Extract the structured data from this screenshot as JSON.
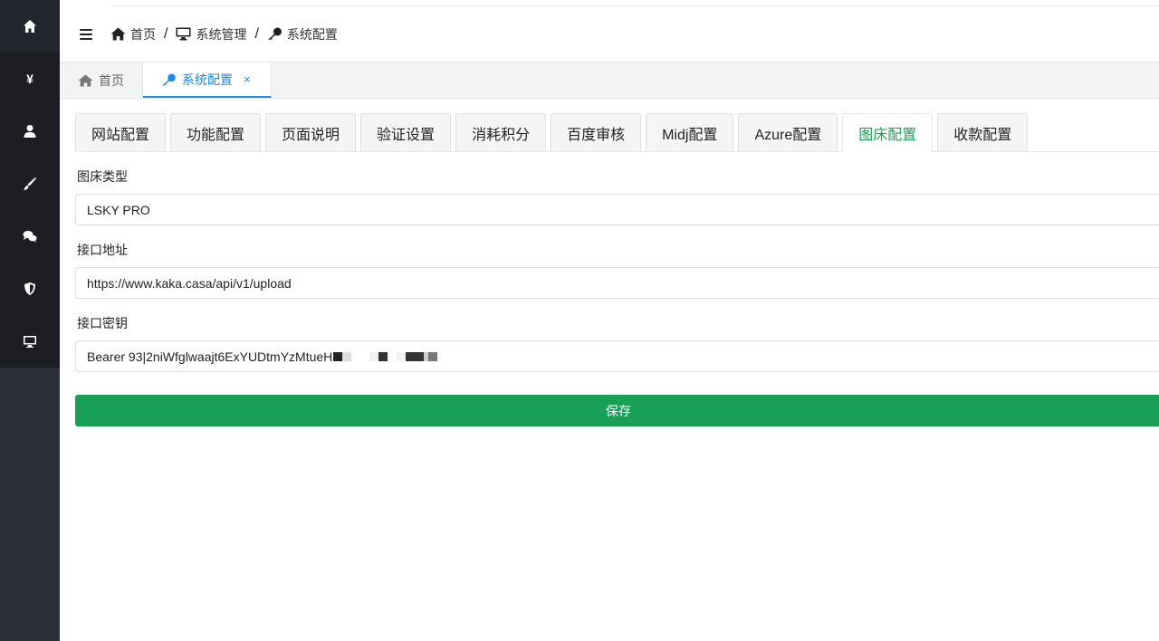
{
  "sidebar": {
    "items": [
      {
        "name": "home",
        "icon": "home-icon"
      },
      {
        "name": "finance",
        "icon": "yen-icon",
        "glyph": "¥"
      },
      {
        "name": "users",
        "icon": "user-icon"
      },
      {
        "name": "drawing",
        "icon": "brush-icon"
      },
      {
        "name": "chat",
        "icon": "chat-icon"
      },
      {
        "name": "security",
        "icon": "shield-icon"
      },
      {
        "name": "system",
        "icon": "monitor-icon"
      }
    ]
  },
  "breadcrumb": {
    "items": [
      {
        "label": "首页",
        "icon": "home-icon"
      },
      {
        "label": "系统管理",
        "icon": "monitor-icon"
      },
      {
        "label": "系统配置",
        "icon": "key-icon"
      }
    ],
    "separator": "/"
  },
  "tags": [
    {
      "label": "首页",
      "icon": "home-icon"
    },
    {
      "label": "系统配置",
      "icon": "key-icon",
      "close": "×"
    }
  ],
  "tabs": [
    "网站配置",
    "功能配置",
    "页面说明",
    "验证设置",
    "消耗积分",
    "百度审核",
    "Midj配置",
    "Azure配置",
    "图床配置",
    "收款配置"
  ],
  "active_tab": "图床配置",
  "form": {
    "type_label": "图床类型",
    "type_value": "LSKY PRO",
    "url_label": "接口地址",
    "url_value": "https://www.kaka.casa/api/v1/upload",
    "key_label": "接口密钥",
    "key_value": "Bearer 93|2niWfglwaajt6ExYUDtmYzMtueH",
    "save_label": "保存"
  },
  "colors": {
    "sidebar_bg": "#2b2f3a",
    "accent_blue": "#1e88e5",
    "accent_green": "#18a058"
  }
}
